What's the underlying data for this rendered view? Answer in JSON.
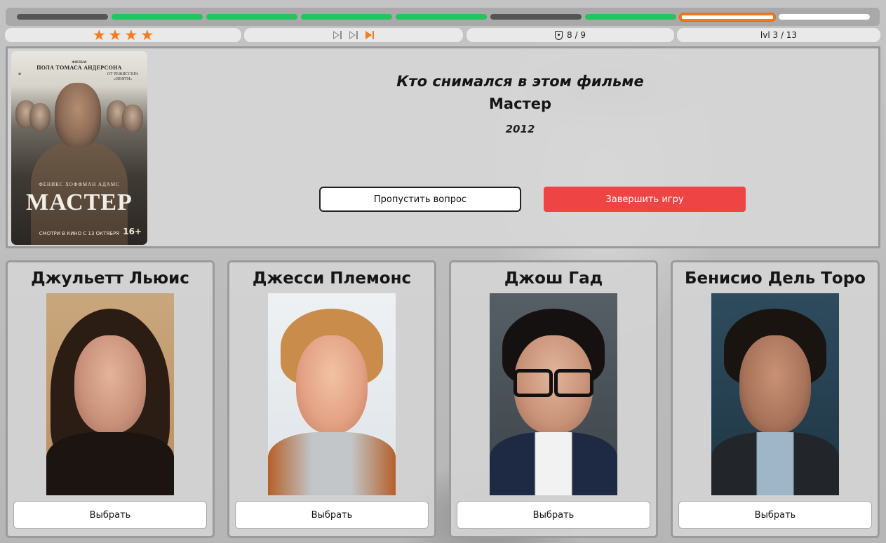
{
  "progress": {
    "segments": [
      "wrong",
      "correct",
      "correct",
      "correct",
      "correct",
      "wrong",
      "correct",
      "current",
      "pending"
    ]
  },
  "stats": {
    "stars": 4,
    "skips": [
      "used",
      "used",
      "active"
    ],
    "lives": "8 / 9",
    "level": "lvl 3 / 13"
  },
  "poster": {
    "credit": "ПОЛА ТОМАСА АНДЕРСОНА",
    "top_label": "ФИЛЬМ",
    "oscar_line": "ОТ РЕЖИССЕРА «НЕФТИ»",
    "actors": "ФЕНИКС  ХОФФМАН  АДАМС",
    "title": "МАСТЕР",
    "date": "СМОТРИ В КИНО С 13 ОКТЯБРЯ",
    "age": "16+"
  },
  "question": {
    "prompt": "Кто снимался в этом фильме",
    "title": "Мастер",
    "year": "2012"
  },
  "actions": {
    "skip_label": "Пропустить вопрос",
    "end_label": "Завершить игру"
  },
  "answers": [
    {
      "name": "Джульетт Льюис",
      "button": "Выбрать"
    },
    {
      "name": "Джесси Племонс",
      "button": "Выбрать"
    },
    {
      "name": "Джош Гад",
      "button": "Выбрать"
    },
    {
      "name": "Бенисио Дель Торо",
      "button": "Выбрать"
    }
  ],
  "colors": {
    "accent": "#f37b20",
    "correct": "#22c55e",
    "danger": "#ef4444"
  }
}
